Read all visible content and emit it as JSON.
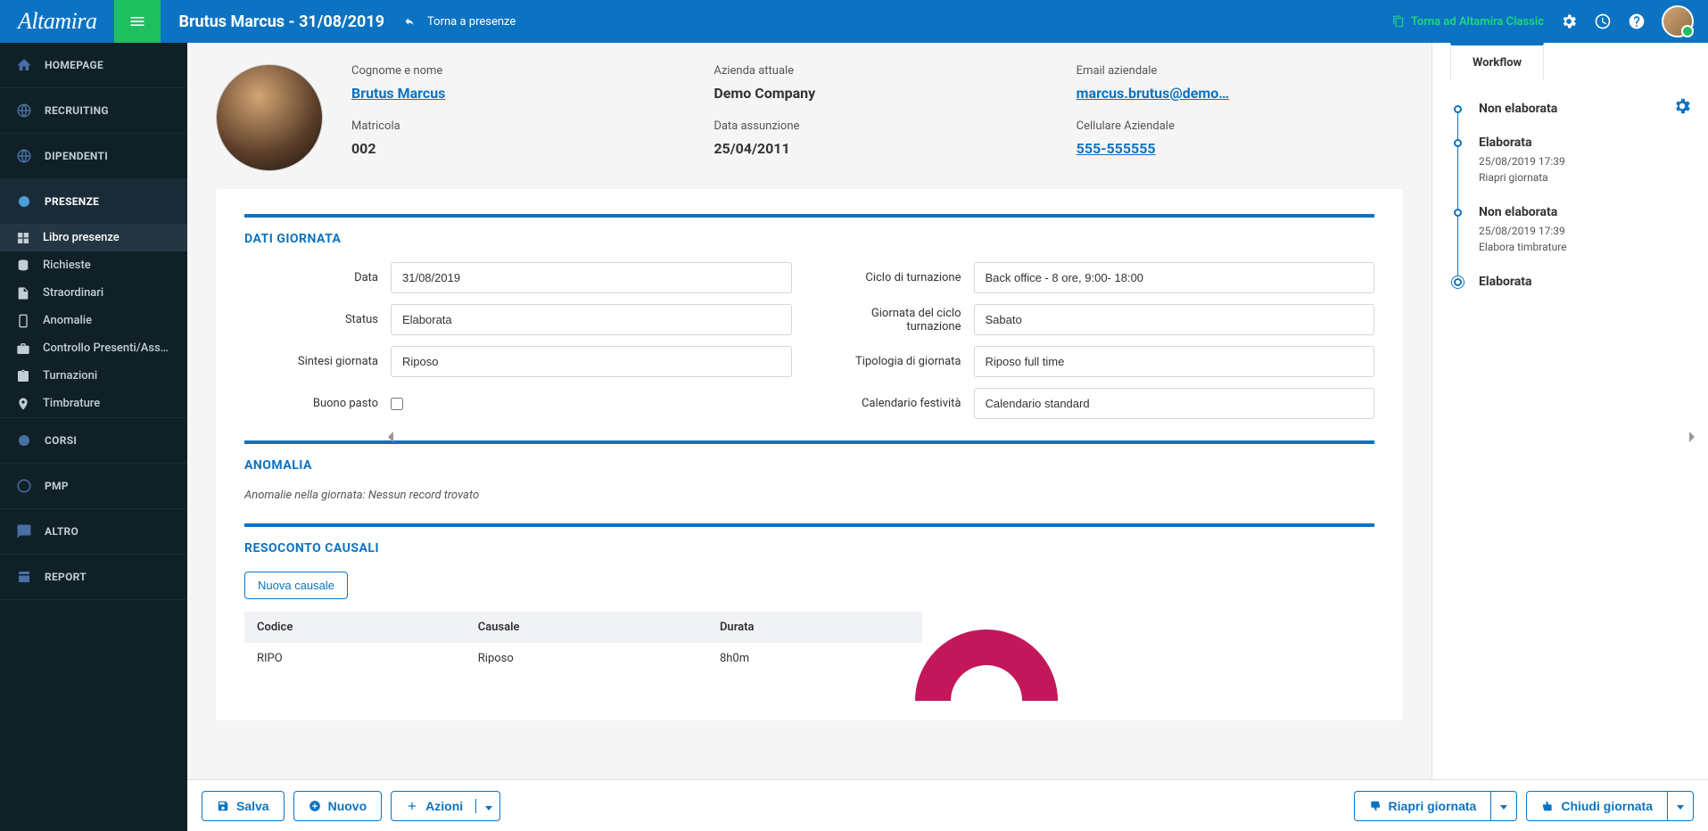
{
  "brand": "Altamira",
  "header": {
    "title": "Brutus Marcus - 31/08/2019",
    "back_label": "Torna a presenze",
    "classic_label": "Torna ad Altamira Classic"
  },
  "nav": {
    "homepage": "HOMEPAGE",
    "recruiting": "RECRUITING",
    "dipendenti": "DIPENDENTI",
    "presenze": "PRESENZE",
    "corsi": "CORSI",
    "pmp": "PMP",
    "altro": "ALTRO",
    "report": "REPORT",
    "sub": {
      "libro": "Libro presenze",
      "richieste": "Richieste",
      "straordinari": "Straordinari",
      "anomalie": "Anomalie",
      "controllo": "Controllo Presenti/Ass…",
      "turnazioni": "Turnazioni",
      "timbrature": "Timbrature"
    }
  },
  "profile": {
    "labels": {
      "cognome_nome": "Cognome e nome",
      "azienda": "Azienda attuale",
      "email": "Email aziendale",
      "matricola": "Matricola",
      "assunzione": "Data assunzione",
      "cellulare": "Cellulare Aziendale"
    },
    "values": {
      "cognome_nome": "Brutus Marcus",
      "azienda": "Demo Company",
      "email": "marcus.brutus@demo…",
      "matricola": "002",
      "assunzione": "25/04/2011",
      "cellulare": "555-555555"
    }
  },
  "dati_giornata": {
    "title": "DATI GIORNATA",
    "labels": {
      "data": "Data",
      "status": "Status",
      "sintesi": "Sintesi giornata",
      "buono": "Buono pasto",
      "ciclo": "Ciclo di turnazione",
      "giornata_ciclo": "Giornata del ciclo turnazione",
      "tipologia": "Tipologia di giornata",
      "calendario": "Calendario festività"
    },
    "values": {
      "data": "31/08/2019",
      "status": "Elaborata",
      "sintesi": "Riposo",
      "ciclo": "Back office - 8 ore, 9:00- 18:00",
      "giornata_ciclo": "Sabato",
      "tipologia": "Riposo full time",
      "calendario": "Calendario standard"
    }
  },
  "anomalia": {
    "title": "ANOMALIA",
    "text": "Anomalie nella giornata: Nessun record trovato"
  },
  "resoconto": {
    "title": "RESOCONTO CAUSALI",
    "new_btn": "Nuova causale",
    "headers": {
      "codice": "Codice",
      "causale": "Causale",
      "durata": "Durata"
    },
    "rows": [
      {
        "codice": "RIPO",
        "causale": "Riposo",
        "durata": "8h0m"
      }
    ]
  },
  "workflow": {
    "tab": "Workflow",
    "steps": [
      {
        "title": "Non elaborata",
        "meta": ""
      },
      {
        "title": "Elaborata",
        "date": "25/08/2019 17:39",
        "action": "Riapri giornata"
      },
      {
        "title": "Non elaborata",
        "date": "25/08/2019 17:39",
        "action": "Elabora timbrature"
      },
      {
        "title": "Elaborata",
        "meta": ""
      }
    ]
  },
  "footer": {
    "salva": "Salva",
    "nuovo": "Nuovo",
    "azioni": "Azioni",
    "riapri": "Riapri giornata",
    "chiudi": "Chiudi giornata"
  }
}
